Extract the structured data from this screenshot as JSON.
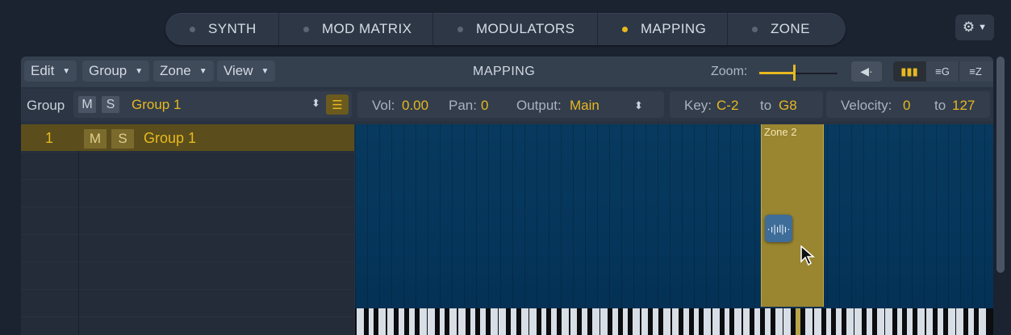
{
  "tabs": [
    {
      "label": "SYNTH",
      "active": false
    },
    {
      "label": "MOD MATRIX",
      "active": false
    },
    {
      "label": "MODULATORS",
      "active": false
    },
    {
      "label": "MAPPING",
      "active": true
    },
    {
      "label": "ZONE",
      "active": false
    }
  ],
  "toolbar": {
    "menus": [
      "Edit",
      "Group",
      "Zone",
      "View"
    ],
    "title": "MAPPING",
    "zoom_label": "Zoom:",
    "zoom_level": 0.45
  },
  "group_row": {
    "label": "Group",
    "mute": "M",
    "solo": "S",
    "group_name": "Group 1",
    "vol_label": "Vol:",
    "vol_value": "0.00",
    "pan_label": "Pan:",
    "pan_value": "0",
    "output_label": "Output:",
    "output_value": "Main",
    "key_label": "Key:",
    "key_low": "C-2",
    "key_to": "to",
    "key_high": "G8",
    "vel_label": "Velocity:",
    "vel_low": "0",
    "vel_to": "to",
    "vel_high": "127"
  },
  "group_list": [
    {
      "number": "1",
      "mute": "M",
      "solo": "S",
      "name": "Group 1"
    }
  ],
  "zone": {
    "label": "Zone 2"
  },
  "colors": {
    "accent": "#e7b820",
    "zone": "#9a8530",
    "grid": "#05355a"
  }
}
